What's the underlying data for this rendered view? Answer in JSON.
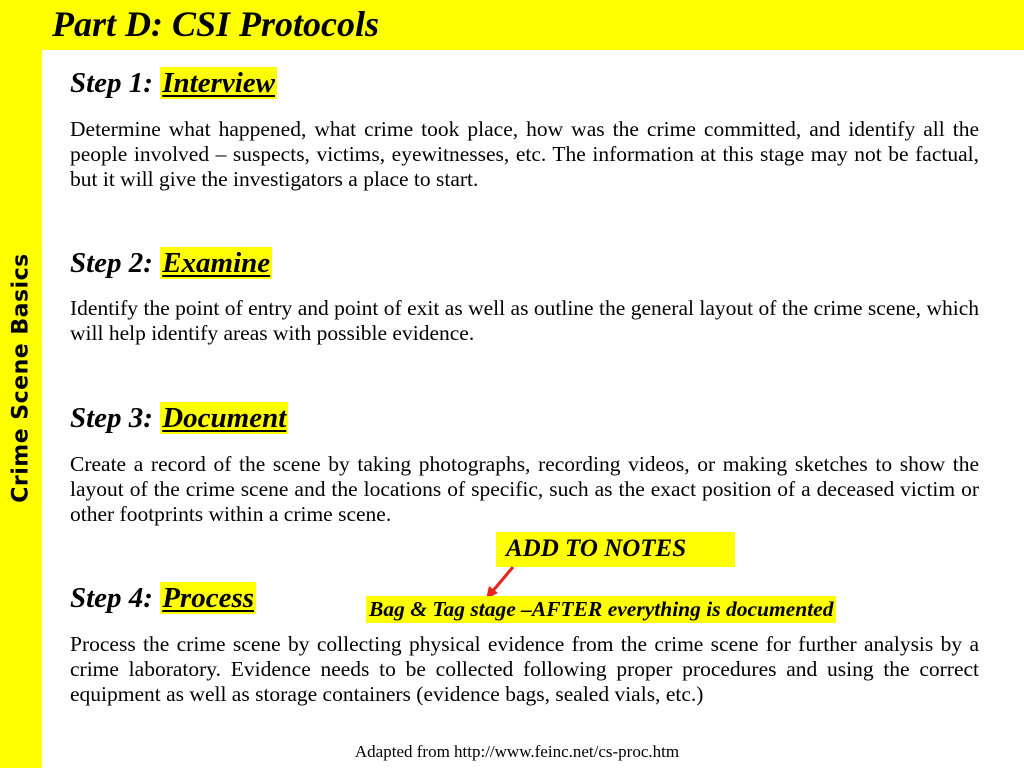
{
  "slide": {
    "title": "Part D: CSI Protocols",
    "side_label": "Crime Scene Basics",
    "accent_color": "#ffff00",
    "arrow_color": "#e8231a"
  },
  "steps": [
    {
      "prefix": "Step 1: ",
      "keyword": "Interview",
      "body": "Determine what happened, what crime took place, how was the crime committed, and identify all the people involved – suspects, victims, eyewitnesses, etc. The information at this stage may not be factual, but it will give the investigators a place to start."
    },
    {
      "prefix": "Step 2: ",
      "keyword": "Examine",
      "body": "Identify the point of entry and point of exit as well as outline the general layout of the crime scene, which will help identify areas with possible evidence."
    },
    {
      "prefix": "Step 3: ",
      "keyword": "Document",
      "body": "Create a record of the scene by taking photographs, recording videos, or making sketches to show the layout of the crime scene and the locations of specific, such as the exact position of a deceased victim or other footprints within a crime scene."
    },
    {
      "prefix": "Step 4: ",
      "keyword": "Process",
      "body": "Process the crime scene by collecting physical evidence from the crime scene for further analysis by a crime laboratory.  Evidence needs to be collected following proper procedures and using the correct equipment as well as storage containers (evidence bags, sealed vials, etc.)"
    }
  ],
  "annotation": {
    "box_label": "ADD TO NOTES",
    "note": "Bag & Tag stage –AFTER everything is documented",
    "arrow_icon": "red-arrow"
  },
  "footer": {
    "source": "Adapted from http://www.feinc.net/cs-proc.htm"
  }
}
